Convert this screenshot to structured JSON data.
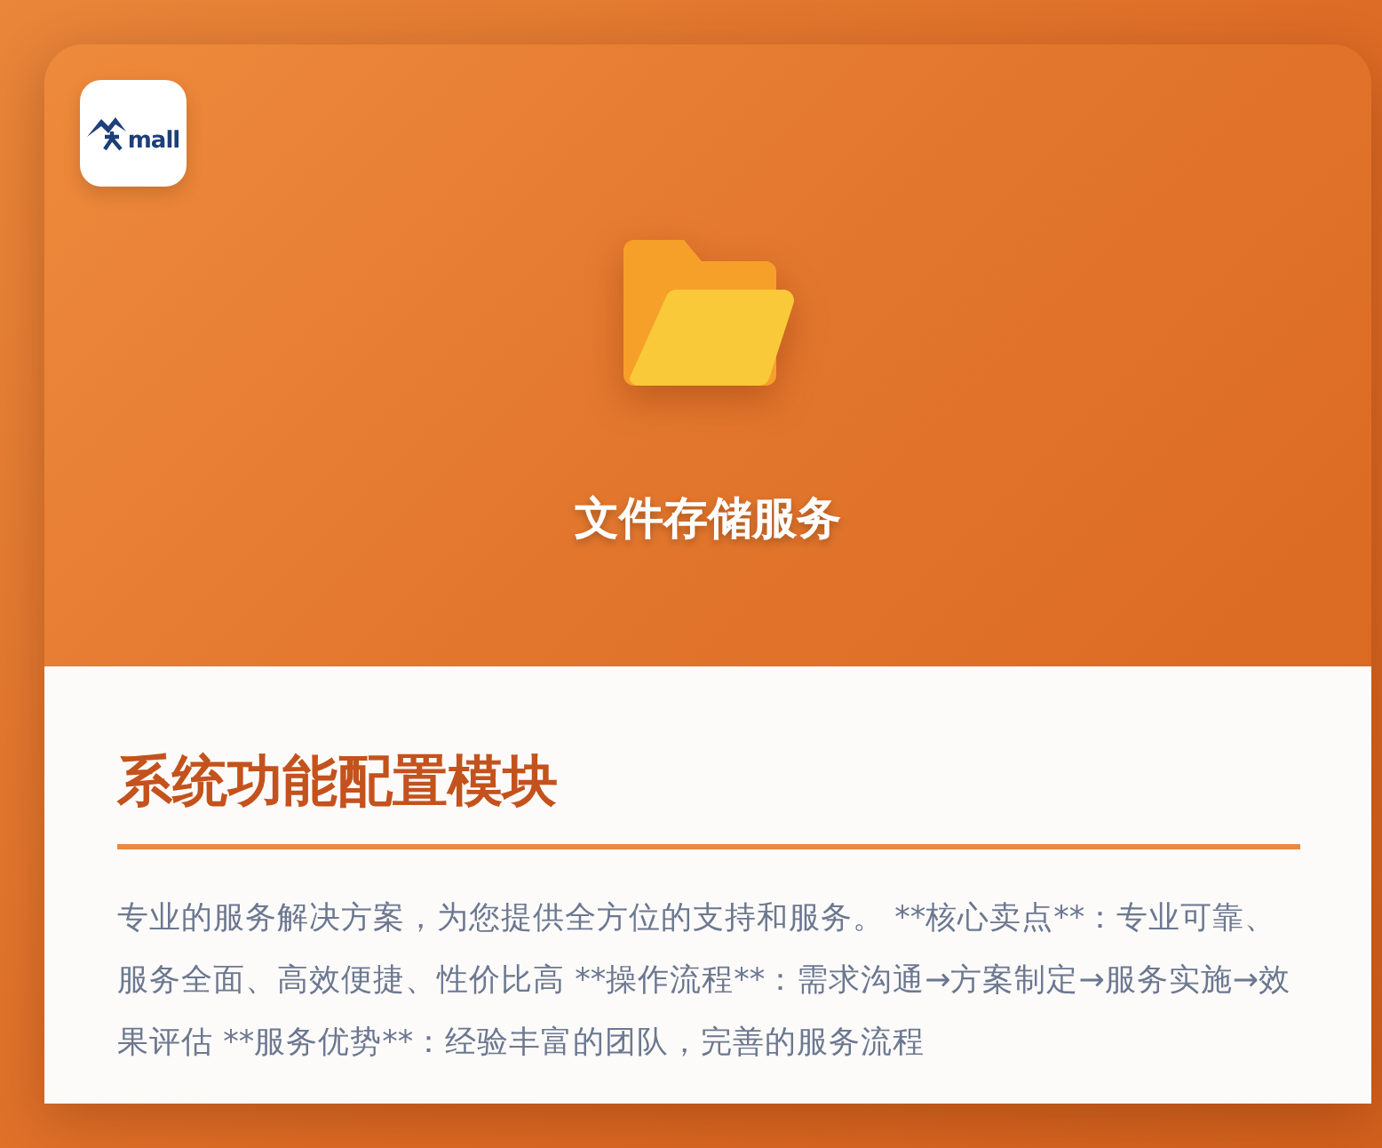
{
  "logo": {
    "text": "mall"
  },
  "header": {
    "title": "文件存储服务"
  },
  "section": {
    "heading": "系统功能配置模块",
    "description": "专业的服务解决方案，为您提供全方位的支持和服务。 **核心卖点**：专业可靠、服务全面、高效便捷、性价比高 **操作流程**：需求沟通→方案制定→服务实施→效果评估 **服务优势**：经验丰富的团队，完善的服务流程"
  }
}
